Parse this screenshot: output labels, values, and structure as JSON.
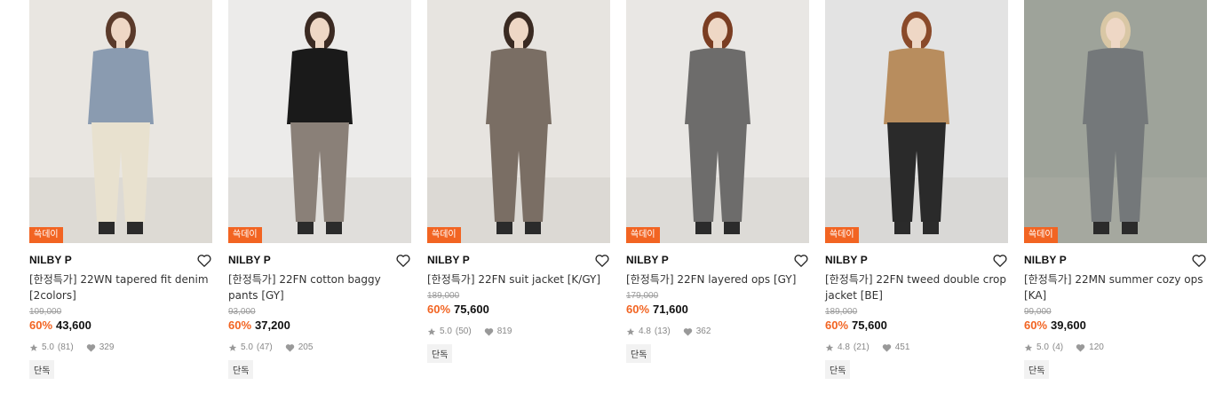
{
  "products": [
    {
      "badge": "쓱데이",
      "brand": "NILBY P",
      "title": "[한정특가] 22WN tapered fit denim [2colors]",
      "original_price": "109,000",
      "discount": "60%",
      "price": "43,600",
      "rating": "5.0",
      "reviews": "(81)",
      "likes": "329",
      "tag": "단독",
      "colors": {
        "bg": "#e9e6e1",
        "top": "#8a9bb0",
        "bottom": "#e8e1cf",
        "hair": "#5a3a2a"
      }
    },
    {
      "badge": "쓱데이",
      "brand": "NILBY P",
      "title": "[한정특가] 22FN cotton baggy pants [GY]",
      "original_price": "93,000",
      "discount": "60%",
      "price": "37,200",
      "rating": "5.0",
      "reviews": "(47)",
      "likes": "205",
      "tag": "단독",
      "colors": {
        "bg": "#ecebea",
        "top": "#1a1a1a",
        "bottom": "#8a8078",
        "hair": "#3b2a22"
      }
    },
    {
      "badge": "쓱데이",
      "brand": "NILBY P",
      "title": "[한정특가] 22FN suit jacket [K/GY]",
      "original_price": "189,000",
      "discount": "60%",
      "price": "75,600",
      "rating": "5.0",
      "reviews": "(50)",
      "likes": "819",
      "tag": "단독",
      "colors": {
        "bg": "#e7e4e0",
        "top": "#7a6e64",
        "bottom": "#7a6e64",
        "hair": "#3a2a22"
      }
    },
    {
      "badge": "쓱데이",
      "brand": "NILBY P",
      "title": "[한정특가] 22FN layered ops [GY]",
      "original_price": "179,000",
      "discount": "60%",
      "price": "71,600",
      "rating": "4.8",
      "reviews": "(13)",
      "likes": "362",
      "tag": "단독",
      "colors": {
        "bg": "#e9e7e4",
        "top": "#6d6c6b",
        "bottom": "#6d6c6b",
        "hair": "#7a3d22"
      }
    },
    {
      "badge": "쓱데이",
      "brand": "NILBY P",
      "title": "[한정특가] 22FN tweed double crop jacket [BE]",
      "original_price": "189,000",
      "discount": "60%",
      "price": "75,600",
      "rating": "4.8",
      "reviews": "(21)",
      "likes": "451",
      "tag": "단독",
      "colors": {
        "bg": "#e3e3e3",
        "top": "#b88d5e",
        "bottom": "#2a2a2a",
        "hair": "#8a4a2a"
      }
    },
    {
      "badge": "쓱데이",
      "brand": "NILBY P",
      "title": "[한정특가] 22MN summer cozy ops [KA]",
      "original_price": "99,000",
      "discount": "60%",
      "price": "39,600",
      "rating": "5.0",
      "reviews": "(4)",
      "likes": "120",
      "tag": "단독",
      "colors": {
        "bg": "#9ea39a",
        "top": "#74787a",
        "bottom": "#74787a",
        "hair": "#d9c7a5"
      }
    }
  ]
}
